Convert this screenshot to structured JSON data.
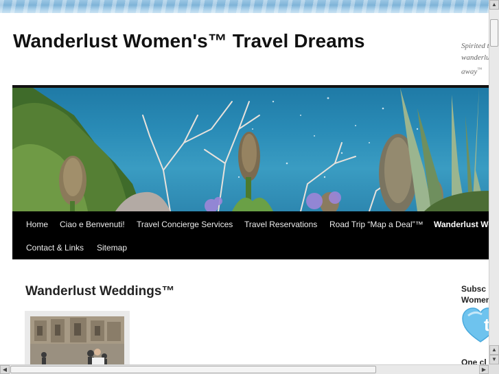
{
  "site": {
    "title": "Wanderlust Women's™ Travel Dreams",
    "tagline_lines": [
      "Spirited t",
      "wanderlu",
      "away"
    ],
    "tagline_tm": "™"
  },
  "nav": {
    "items": [
      {
        "label": "Home"
      },
      {
        "label": "Ciao e Benvenuti!"
      },
      {
        "label": "Travel Concierge Services"
      },
      {
        "label": "Travel Reservations"
      },
      {
        "label": "Road Trip “Map a Deal”™"
      },
      {
        "label": "Wanderlust We"
      },
      {
        "label": "Contact & Links"
      },
      {
        "label": "Sitemap"
      }
    ],
    "active_index": 5
  },
  "post": {
    "title": "Wanderlust Weddings™"
  },
  "sidebar": {
    "subscribe_heading_lines": [
      "Subsc",
      "Women"
    ],
    "badge_icon": "twitter-heart-icon",
    "next_heading": "One cl"
  },
  "colors": {
    "nav_bg": "#000000",
    "sea": "#2a8cb7",
    "badge": "#6ec3ee"
  }
}
